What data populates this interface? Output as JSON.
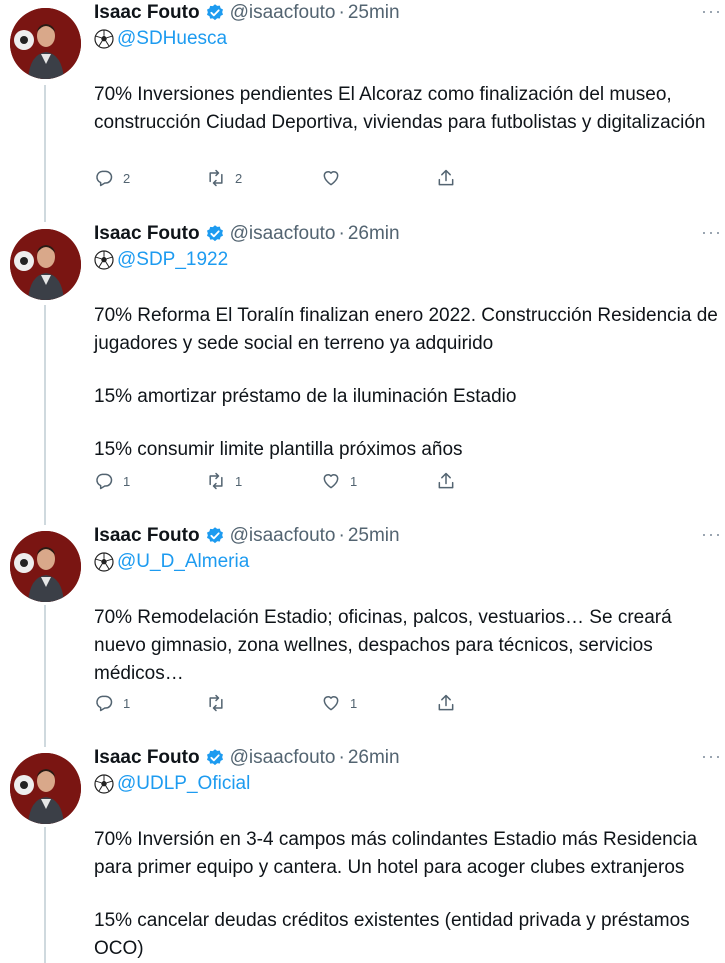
{
  "tweets": [
    {
      "author": "Isaac Fouto",
      "handle": "@isaacfouto",
      "separator": "·",
      "time": "25min",
      "mention": "@SDHuesca",
      "paragraphs": [
        "70% Inversiones pendientes El Alcoraz como finalización del museo, construcción Ciudad Deportiva, viviendas para futbolistas y digitalización"
      ],
      "replies": "2",
      "retweets": "2",
      "likes": "",
      "more": "···"
    },
    {
      "author": "Isaac Fouto",
      "handle": "@isaacfouto",
      "separator": "·",
      "time": "26min",
      "mention": "@SDP_1922",
      "paragraphs": [
        "70% Reforma El Toralín finalizan enero 2022. Construcción Residencia de jugadores y sede social en terreno ya adquirido",
        "15% amortizar préstamo de la iluminación Estadio",
        "15% consumir limite plantilla próximos años"
      ],
      "replies": "1",
      "retweets": "1",
      "likes": "1",
      "more": "···"
    },
    {
      "author": "Isaac Fouto",
      "handle": "@isaacfouto",
      "separator": "·",
      "time": "25min",
      "mention": "@U_D_Almeria",
      "paragraphs": [
        "70% Remodelación Estadio; oficinas, palcos, vestuarios… Se creará nuevo gimnasio, zona wellnes, despachos para técnicos, servicios médicos…"
      ],
      "replies": "1",
      "retweets": "",
      "likes": "1",
      "more": "···"
    },
    {
      "author": "Isaac Fouto",
      "handle": "@isaacfouto",
      "separator": "·",
      "time": "26min",
      "mention": "@UDLP_Oficial",
      "paragraphs": [
        "70% Inversión en 3-4 campos más colindantes Estadio más Residencia para primer equipo y cantera. Un hotel para acoger clubes extranjeros",
        "15% cancelar deudas créditos existentes (entidad privada y préstamos OCO)"
      ],
      "replies": "",
      "retweets": "",
      "likes": "",
      "more": "···"
    }
  ],
  "colors": {
    "accent": "#1d9bf0",
    "secondary": "#536471",
    "text": "#0f1419",
    "thread": "#cfd9de"
  },
  "icons": [
    "verified-badge-icon",
    "soccer-ball-icon",
    "reply-icon",
    "retweet-icon",
    "like-icon",
    "share-icon",
    "more-options-icon",
    "avatar-photo"
  ]
}
